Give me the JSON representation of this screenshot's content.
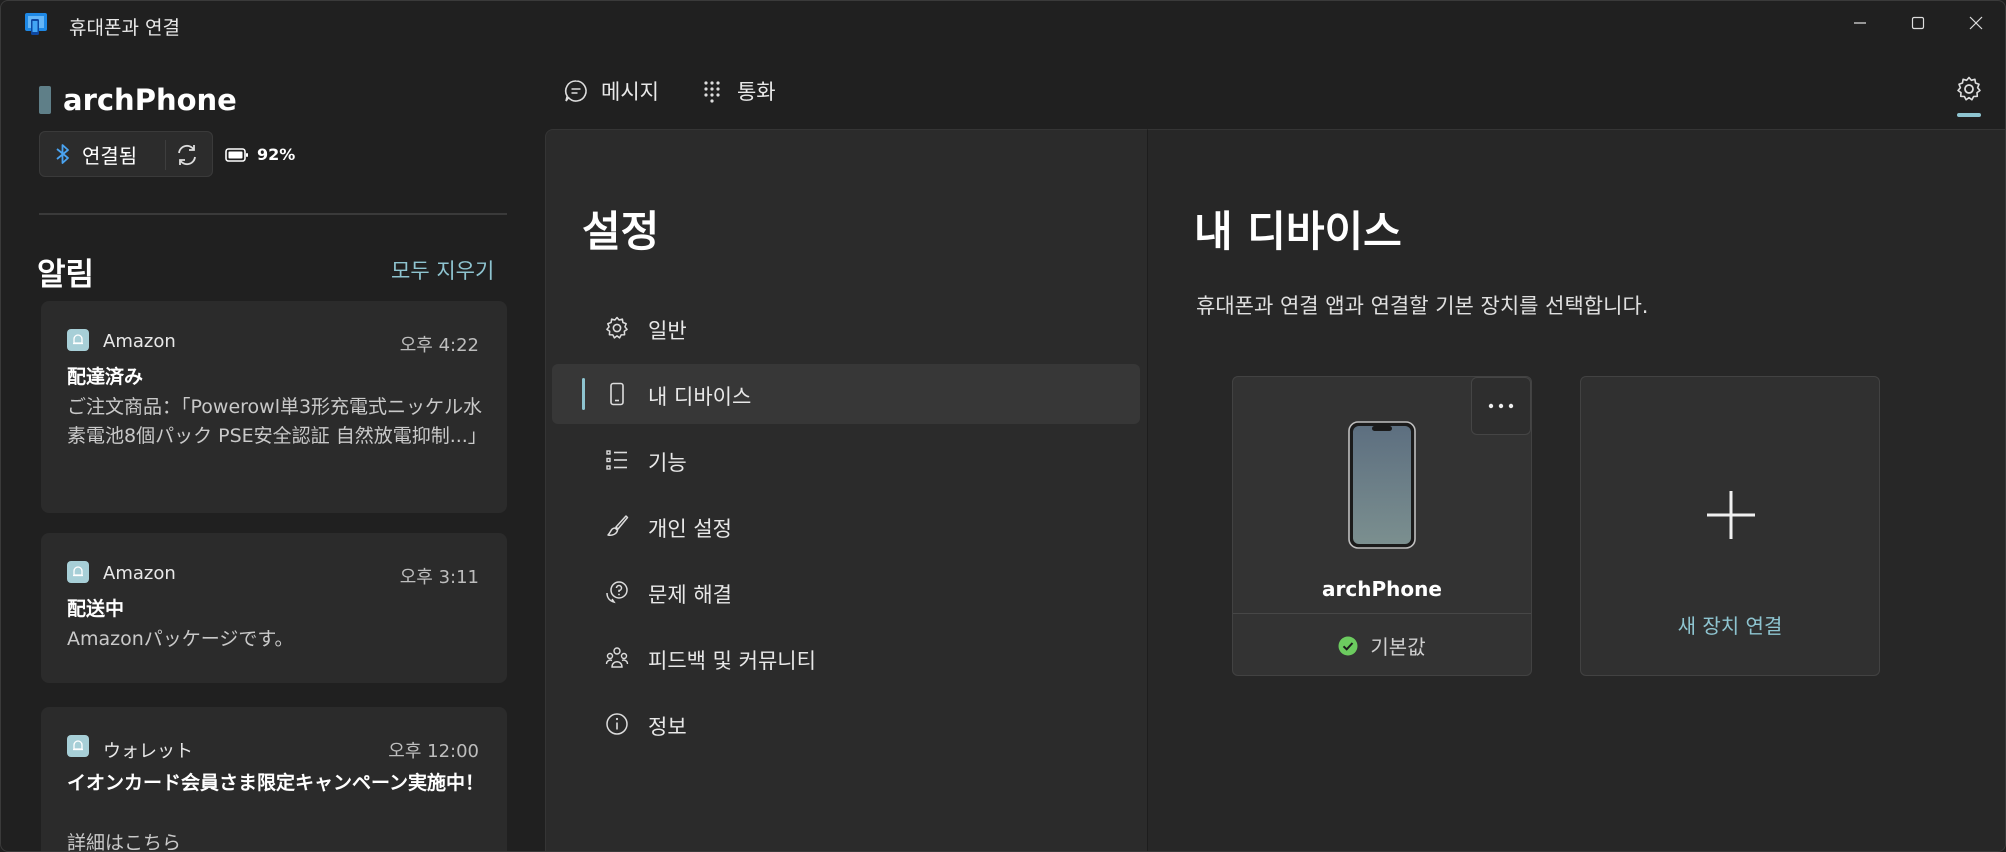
{
  "window": {
    "title": "휴대폰과 연결"
  },
  "device": {
    "name": "archPhone",
    "connection_label": "연결됨",
    "battery": "92%"
  },
  "alerts": {
    "title": "알림",
    "clear_all": "모두 지우기",
    "items": [
      {
        "app": "Amazon",
        "time": "오후 4:22",
        "title": "配達済み",
        "body": "ご注文商品：「Powerowl単3形充電式ニッケル水素電池8個パック PSE安全認証 自然放電抑制...」"
      },
      {
        "app": "Amazon",
        "time": "오후 3:11",
        "title": "配送中",
        "body": "Amazonパッケージです。"
      },
      {
        "app": "ウォレット",
        "time": "오후 12:00",
        "title": "イオンカード会員さま限定キャンペーン実施中！",
        "body": "詳細はこちら"
      }
    ]
  },
  "nav": {
    "tabs": [
      {
        "label": "메시지",
        "icon": "message-icon"
      },
      {
        "label": "통화",
        "icon": "dialpad-icon"
      }
    ],
    "settings_icon": "gear-icon"
  },
  "settings": {
    "title": "설정",
    "menu": [
      {
        "label": "일반",
        "icon": "gear-icon"
      },
      {
        "label": "내 디바이스",
        "icon": "phone-icon",
        "active": true
      },
      {
        "label": "기능",
        "icon": "list-icon"
      },
      {
        "label": "개인 설정",
        "icon": "brush-icon"
      },
      {
        "label": "문제 해결",
        "icon": "help-icon"
      },
      {
        "label": "피드백 및 커뮤니티",
        "icon": "community-icon"
      },
      {
        "label": "정보",
        "icon": "info-icon"
      }
    ]
  },
  "detail": {
    "title": "내 디바이스",
    "description": "휴대폰과 연결 앱과 연결할 기본 장치를 선택합니다.",
    "device_card": {
      "name": "archPhone",
      "default_label": "기본값"
    },
    "add_card": {
      "label": "새 장치 연결"
    }
  },
  "colors": {
    "accent": "#8ec4d0",
    "background": "#202020",
    "ok_green": "#6ccb5f"
  }
}
